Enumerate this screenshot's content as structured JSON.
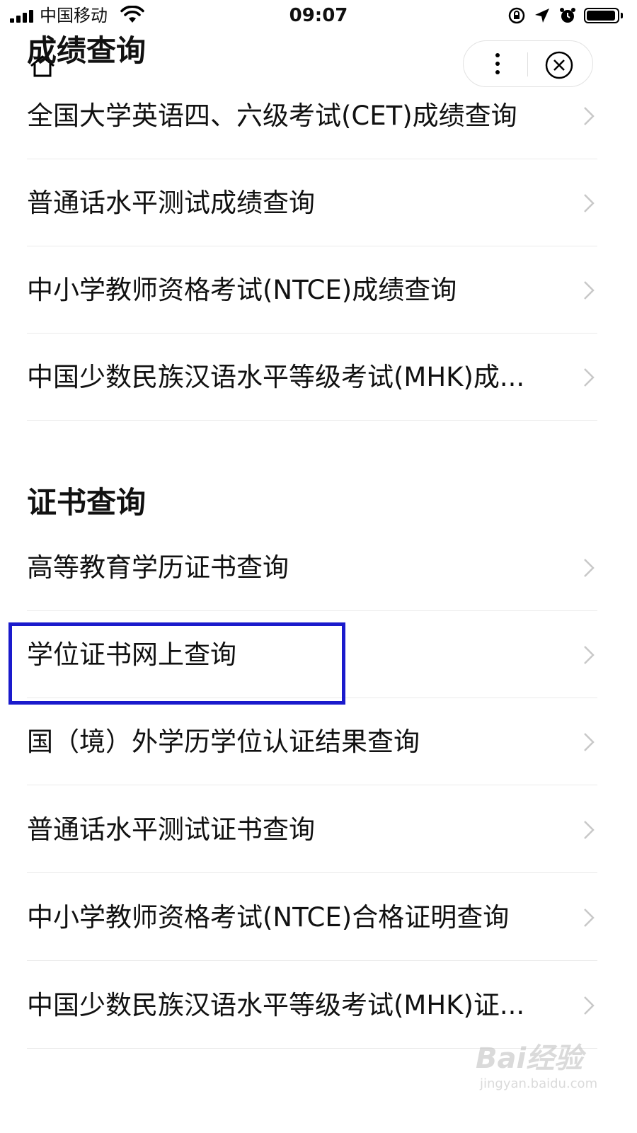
{
  "status_bar": {
    "carrier": "中国移动",
    "time": "09:07",
    "battery_level": 0.95
  },
  "sections": [
    {
      "title": "成绩查询",
      "items": [
        "全国大学英语四、六级考试(CET)成绩查询",
        "普通话水平测试成绩查询",
        "中小学教师资格考试(NTCE)成绩查询",
        "中国少数民族汉语水平等级考试(MHK)成..."
      ]
    },
    {
      "title": "证书查询",
      "items": [
        "高等教育学历证书查询",
        "学位证书网上查询",
        "国（境）外学历学位认证结果查询",
        "普通话水平测试证书查询",
        "中小学教师资格考试(NTCE)合格证明查询",
        "中国少数民族汉语水平等级考试(MHK)证..."
      ]
    }
  ],
  "highlight": {
    "color": "#1a1acc",
    "target": "学位证书网上查询"
  },
  "watermark": {
    "line1": "Bai经验",
    "line2": "jingyan.baidu.com"
  },
  "icons": {
    "signal": "cellular-signal-icon",
    "wifi": "wifi-icon",
    "rotation_lock": "rotation-lock-icon",
    "location": "location-arrow-icon",
    "alarm": "alarm-icon",
    "battery": "battery-icon",
    "more": "more-dots-icon",
    "close": "close-circle-icon",
    "home": "home-icon",
    "chevron": "chevron-right-icon"
  }
}
